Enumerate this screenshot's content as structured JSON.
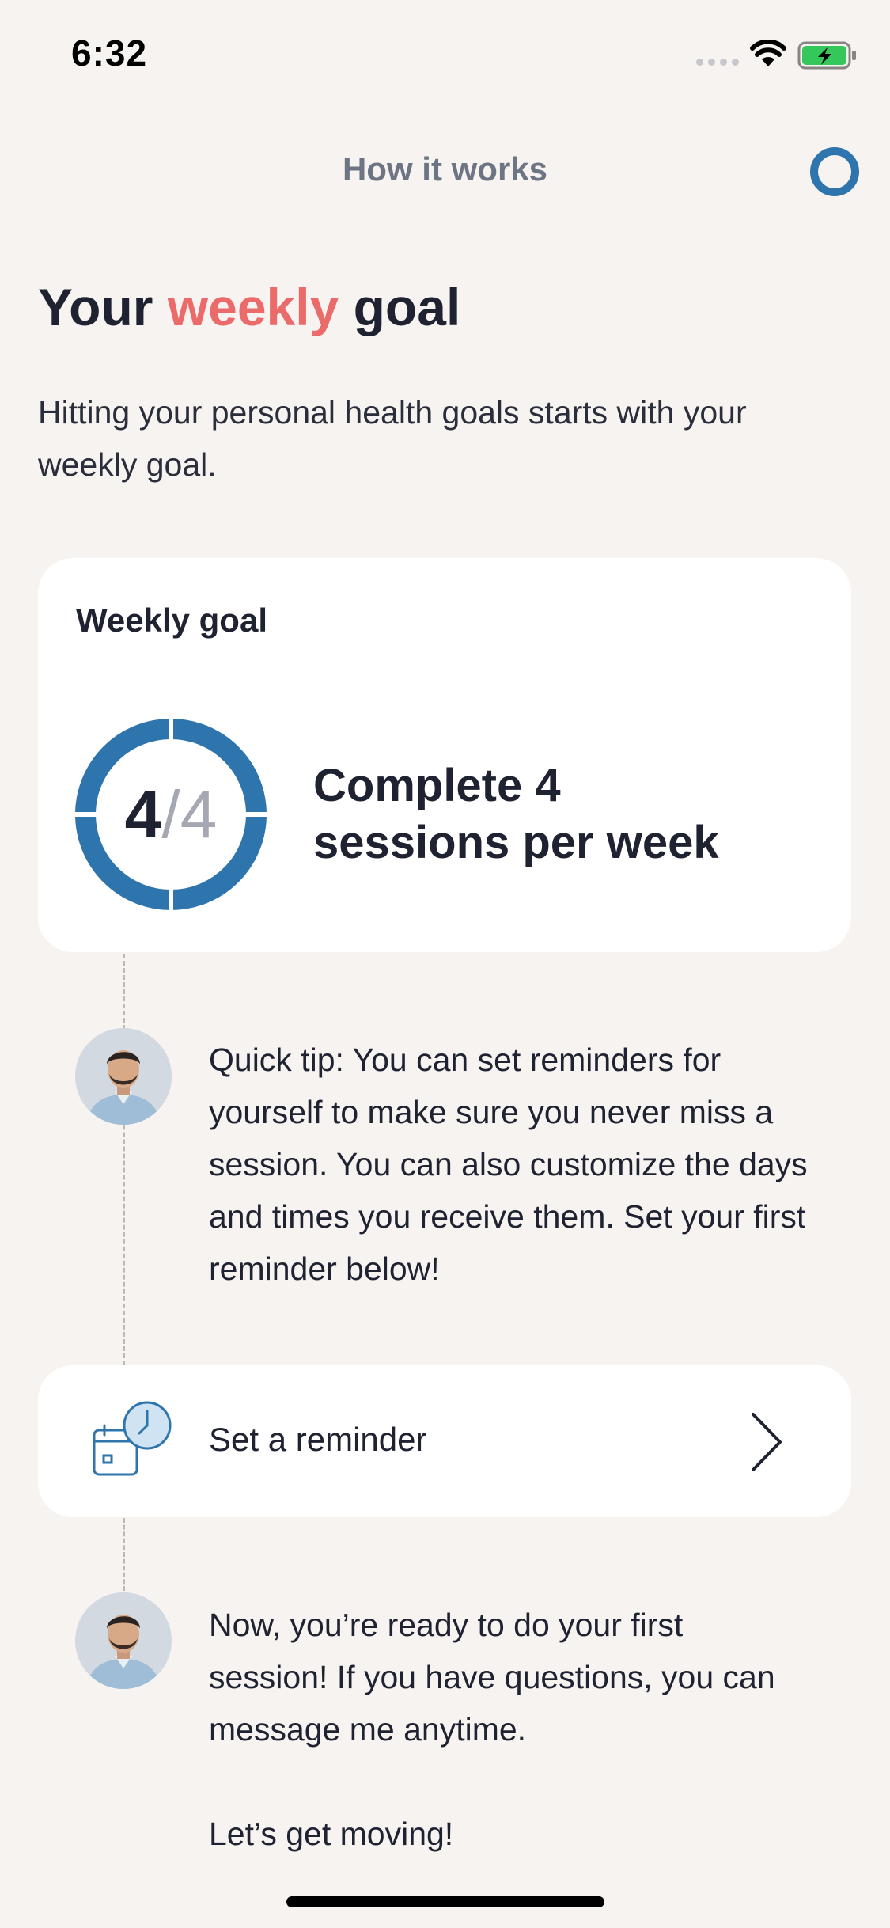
{
  "status_bar": {
    "time": "6:32",
    "icons": [
      "cellular-signal-icon",
      "wifi-icon",
      "battery-charging-icon"
    ],
    "battery_color": "#34c759"
  },
  "header": {
    "title": "How it works",
    "progress_icon": "progress-ring-icon"
  },
  "intro": {
    "title_prefix": "Your ",
    "title_accent": "weekly",
    "title_suffix": " goal",
    "subtitle": "Hitting your personal health goals starts with your weekly goal."
  },
  "goal_card": {
    "label": "Weekly goal",
    "completed": "4",
    "separator": "/",
    "target": "4",
    "text_line1": "Complete 4",
    "text_line2": "sessions per week",
    "progress_fraction": 1.0
  },
  "messages": [
    {
      "avatar": "coach-avatar",
      "text": "Quick tip: You can set reminders for yourself to make sure you never miss a session. You can also customize the days and times you receive them. Set your first reminder below!"
    },
    {
      "avatar": "coach-avatar",
      "text": "Now, you’re ready to do your first session! If you have questions, you can message me anytime."
    }
  ],
  "reminder": {
    "label": "Set a reminder",
    "icon": "calendar-clock-icon",
    "chevron": "chevron-right-icon"
  },
  "closing": "Let’s get moving!",
  "colors": {
    "accent_red": "#eb6a6a",
    "ring_blue": "#2e74ad",
    "background": "#f7f3f1",
    "card": "#ffffff"
  }
}
